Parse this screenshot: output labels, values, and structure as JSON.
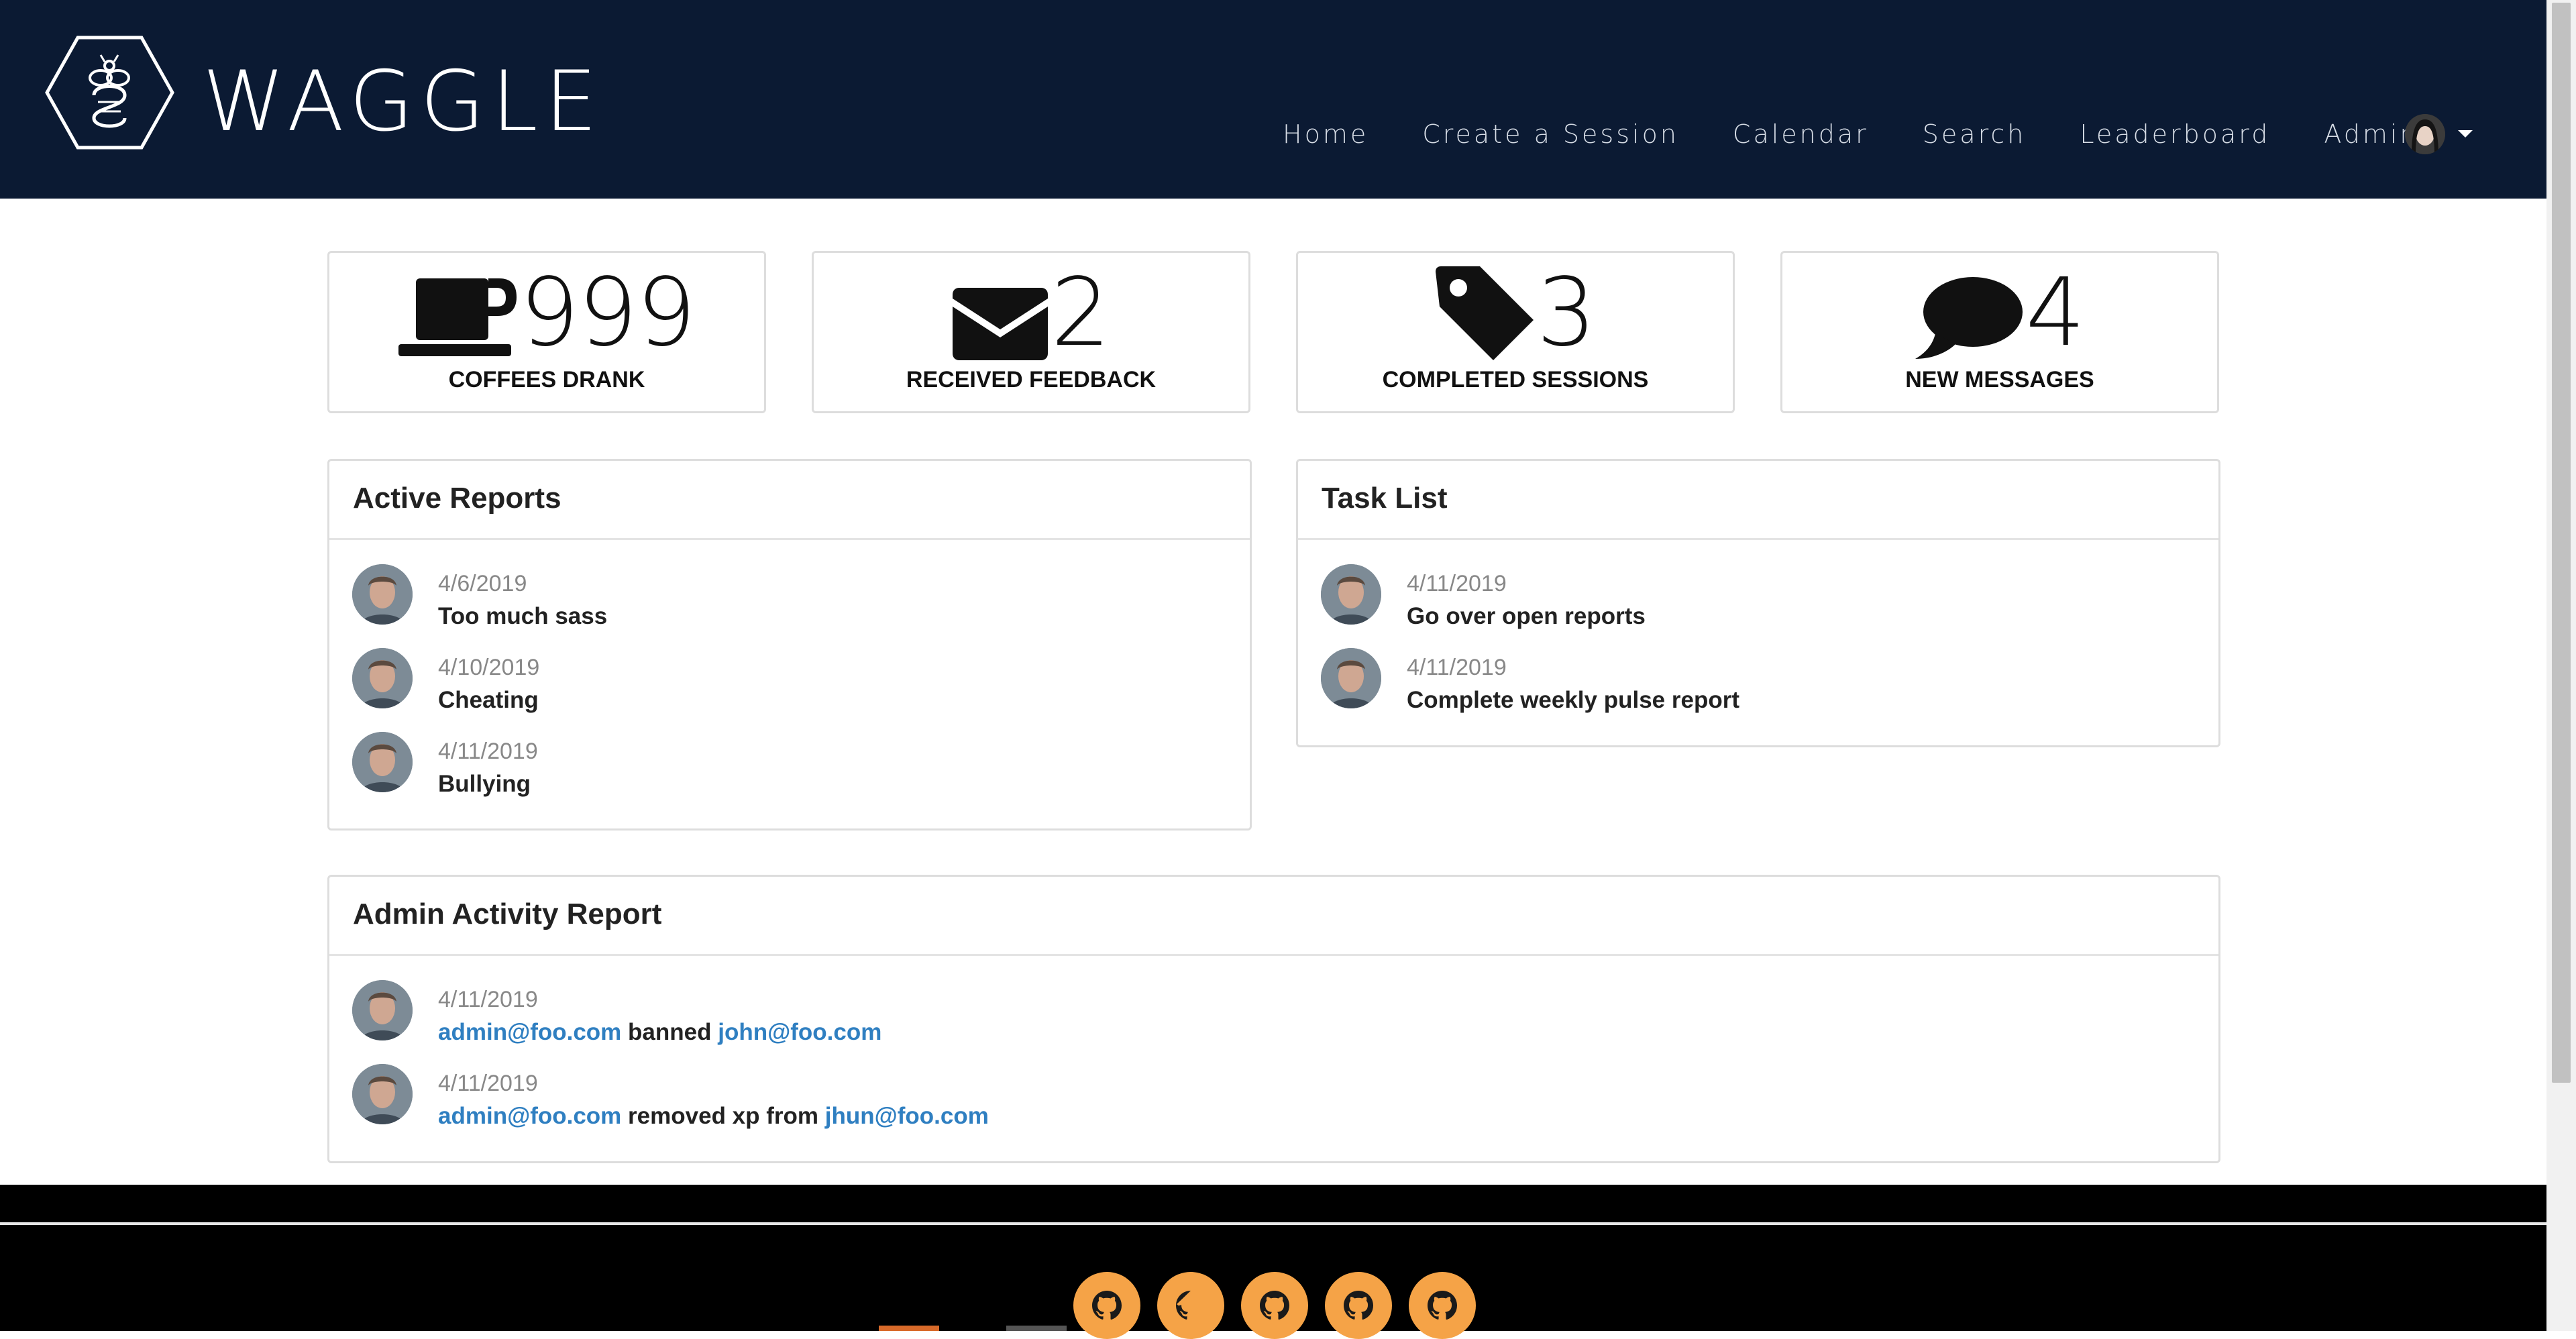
{
  "brand": {
    "name": "WAGGLE"
  },
  "nav": {
    "links": [
      "Home",
      "Create a Session",
      "Calendar",
      "Search",
      "Leaderboard",
      "Admin"
    ]
  },
  "stats": [
    {
      "value": "999",
      "label": "COFFEES DRANK",
      "icon": "coffee-icon"
    },
    {
      "value": "2",
      "label": "RECEIVED FEEDBACK",
      "icon": "envelope-icon"
    },
    {
      "value": "3",
      "label": "COMPLETED SESSIONS",
      "icon": "tag-icon"
    },
    {
      "value": "4",
      "label": "NEW MESSAGES",
      "icon": "speech-bubble-icon"
    }
  ],
  "active_reports": {
    "title": "Active Reports",
    "items": [
      {
        "date": "4/6/2019",
        "text": "Too much sass"
      },
      {
        "date": "4/10/2019",
        "text": "Cheating"
      },
      {
        "date": "4/11/2019",
        "text": "Bullying"
      }
    ]
  },
  "task_list": {
    "title": "Task List",
    "items": [
      {
        "date": "4/11/2019",
        "text": "Go over open reports"
      },
      {
        "date": "4/11/2019",
        "text": "Complete weekly pulse report"
      }
    ]
  },
  "admin_activity": {
    "title": "Admin Activity Report",
    "items": [
      {
        "date": "4/11/2019",
        "actor": "admin@foo.com",
        "action": "banned",
        "target": "john@foo.com"
      },
      {
        "date": "4/11/2019",
        "actor": "admin@foo.com",
        "action": "removed xp from",
        "target": "jhun@foo.com"
      }
    ]
  },
  "footer": {
    "icons": [
      "github-icon",
      "github-icon",
      "github-icon",
      "github-icon",
      "github-icon"
    ],
    "button_color": "#f5a347"
  },
  "colors": {
    "navbar": "#0b1a33",
    "link": "#2f7fc1",
    "footer": "#000000"
  }
}
